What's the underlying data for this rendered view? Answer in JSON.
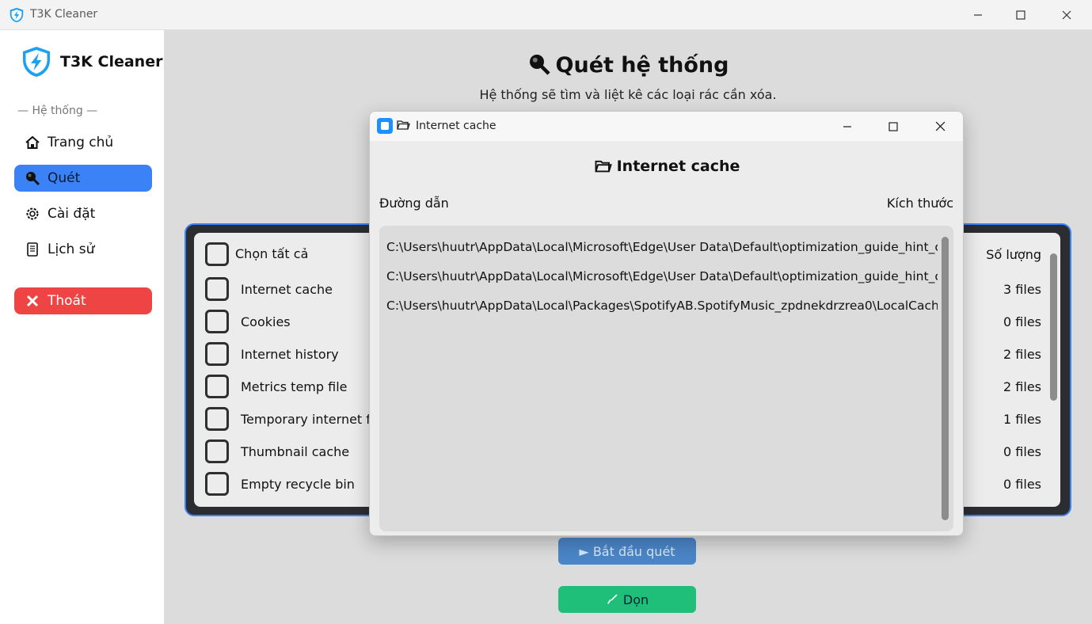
{
  "window": {
    "title": "T3K Cleaner"
  },
  "sidebar": {
    "brand": "T3K Cleaner",
    "section": "— Hệ thống —",
    "items": [
      {
        "label": "Trang chủ",
        "icon": "home-icon"
      },
      {
        "label": "Quét",
        "icon": "magnifier-icon"
      },
      {
        "label": "Cài đặt",
        "icon": "gear-icon"
      },
      {
        "label": "Lịch sử",
        "icon": "scroll-icon"
      }
    ],
    "exit": "Thoát"
  },
  "main": {
    "title": "Quét hệ thống",
    "subtitle": "Hệ thống sẽ tìm và liệt kê các loại rác cần xóa.",
    "select_all": "Chọn tất cả",
    "count_header": "Số lượng",
    "categories": [
      {
        "label": "Internet cache",
        "count": "3 files"
      },
      {
        "label": "Cookies",
        "count": "0 files"
      },
      {
        "label": "Internet history",
        "count": "2 files"
      },
      {
        "label": "Metrics temp file",
        "count": "2 files"
      },
      {
        "label": "Temporary internet files",
        "count": "1 files"
      },
      {
        "label": "Thumbnail cache",
        "count": "0 files"
      },
      {
        "label": "Empty recycle bin",
        "count": "0 files"
      }
    ],
    "scan_button": "► Bắt đầu quét",
    "clean_button": "Dọn"
  },
  "dialog": {
    "title": "Internet cache",
    "heading": "Internet cache",
    "col_path": "Đường dẫn",
    "col_size": "Kích thước",
    "paths": [
      "C:\\Users\\huutr\\AppData\\Local\\Microsoft\\Edge\\User Data\\Default\\optimization_guide_hint_cache_store",
      "C:\\Users\\huutr\\AppData\\Local\\Microsoft\\Edge\\User Data\\Default\\optimization_guide_hint_cache_store",
      "C:\\Users\\huutr\\AppData\\Local\\Packages\\SpotifyAB.SpotifyMusic_zpdnekdrzrea0\\LocalCache\\Spotify"
    ]
  },
  "colors": {
    "accent": "#3b82f6",
    "danger": "#ef4444",
    "success": "#1fbf7a",
    "scan": "#4a86c8"
  }
}
